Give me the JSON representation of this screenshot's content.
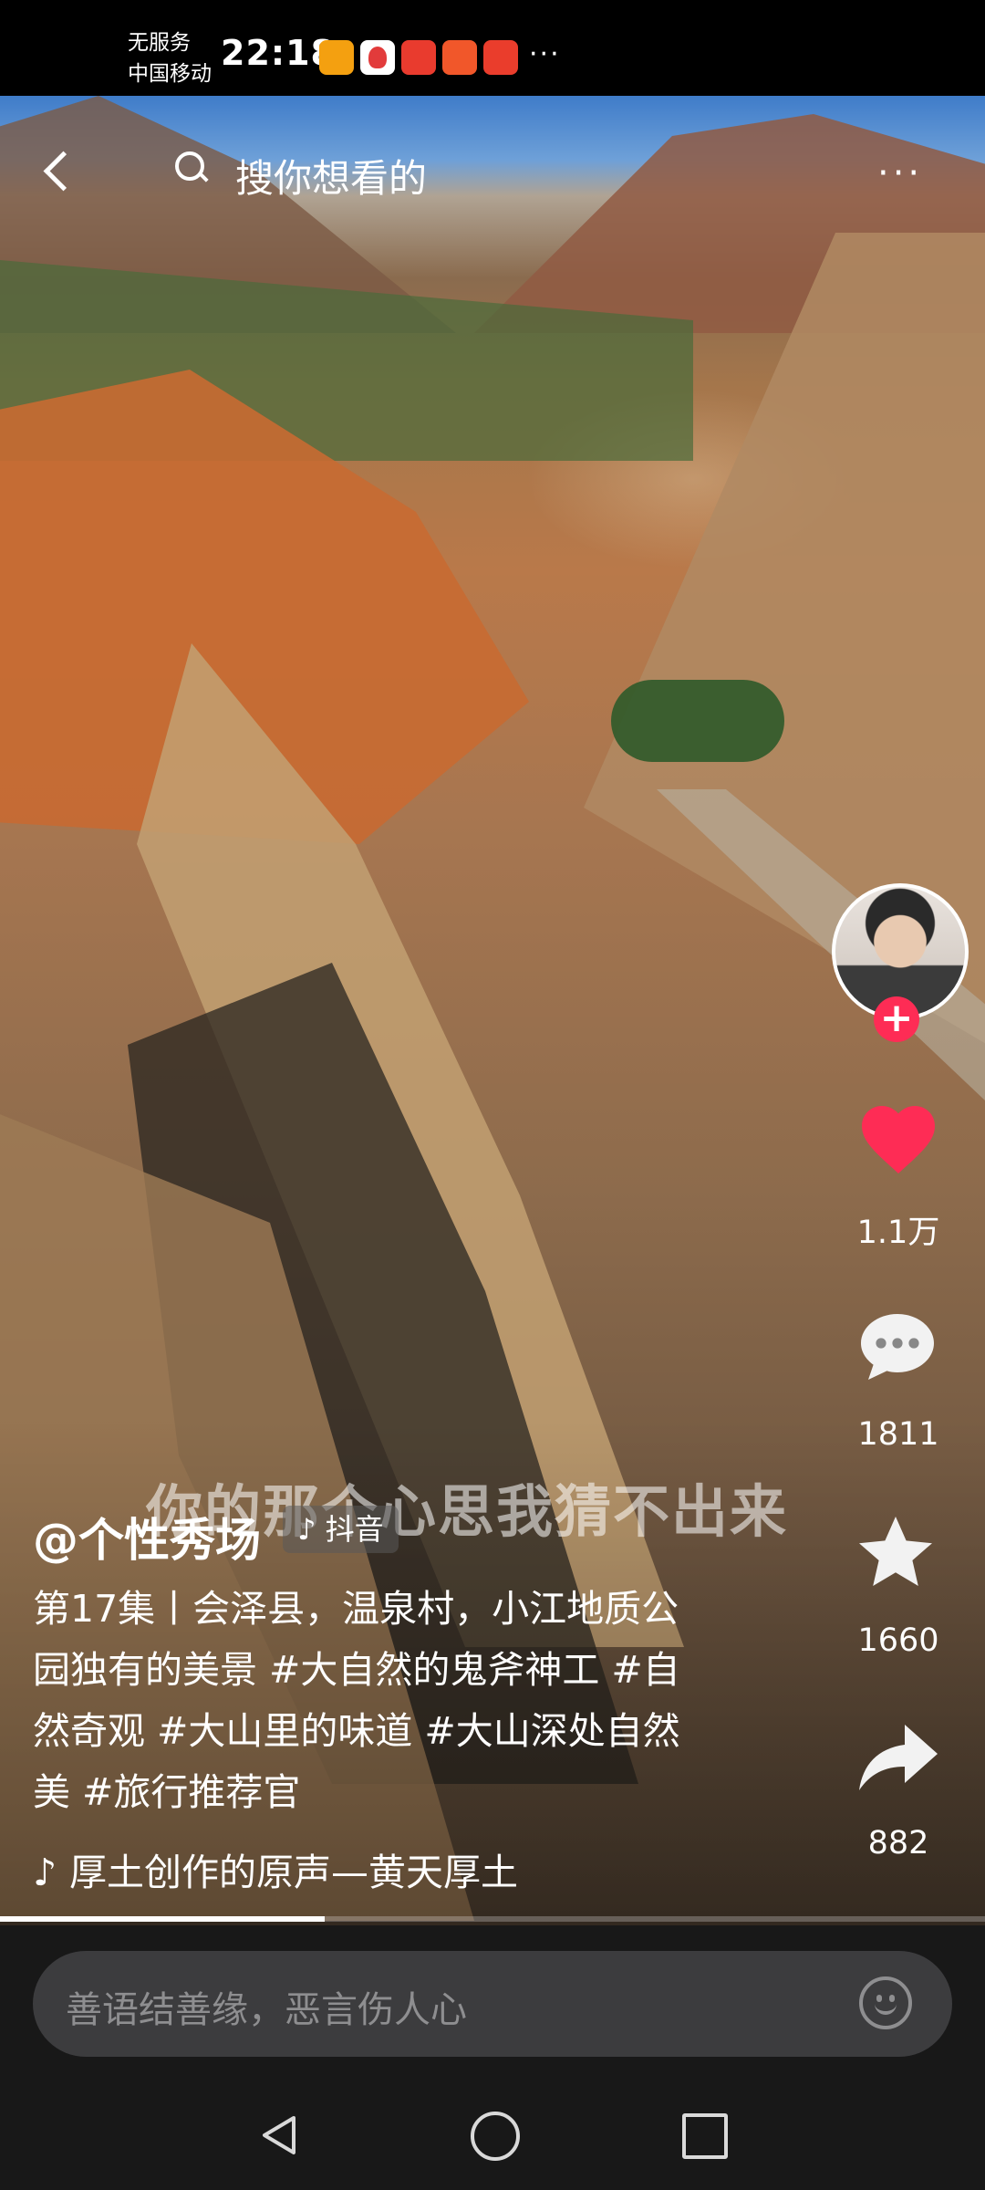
{
  "status_bar": {
    "carrier_line1": "无服务",
    "carrier_line2": "中国移动",
    "time": "22:18",
    "overflow": "···",
    "app_icons": [
      "app-icon",
      "app-icon",
      "huawei-icon",
      "app-icon",
      "app-icon"
    ]
  },
  "top_nav": {
    "back_icon": "chevron-left-icon",
    "search_placeholder": "搜你想看的",
    "search_icon": "search-icon",
    "more_label": "···"
  },
  "actions": {
    "follow_label": "+",
    "like_count": "1.1万",
    "comment_count": "1811",
    "favorite_count": "1660",
    "share_count": "882",
    "like_color": "#fe2c55"
  },
  "post": {
    "lyric": "你的那个心思我猜不出来",
    "author": "@个性秀场",
    "platform_badge": "♪ 抖音",
    "description": "第17集丨会泽县，温泉村，小江地质公园独有的美景 #大自然的鬼斧神工 #自然奇观 #大山里的味道 #大山深处自然美 #旅行推荐官",
    "music_icon": "music-note-icon",
    "music": "厚土创作的原声—黄天厚土"
  },
  "playback": {
    "progress": 0.33
  },
  "comment_bar": {
    "placeholder": "善语结善缘，恶言伤人心",
    "emoji_icon": "emoji-icon"
  },
  "system_nav": {
    "back": "nav-back-icon",
    "home": "nav-home-icon",
    "recent": "nav-recent-icon"
  }
}
